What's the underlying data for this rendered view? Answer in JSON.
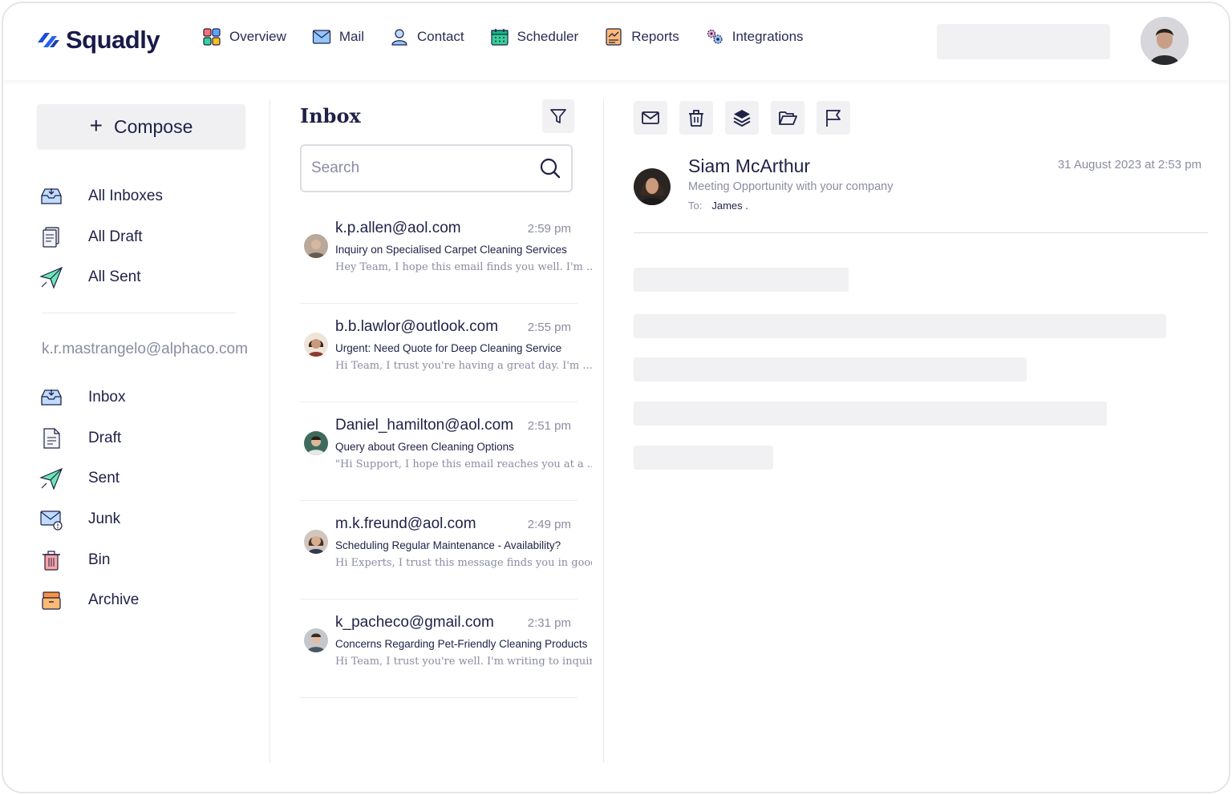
{
  "brand": {
    "name": "Squadly"
  },
  "nav": {
    "items": [
      {
        "label": "Overview",
        "icon": "overview-icon"
      },
      {
        "label": "Mail",
        "icon": "mail-icon"
      },
      {
        "label": "Contact",
        "icon": "contact-icon"
      },
      {
        "label": "Scheduler",
        "icon": "calendar-icon"
      },
      {
        "label": "Reports",
        "icon": "report-icon"
      },
      {
        "label": "Integrations",
        "icon": "integrations-icon"
      }
    ]
  },
  "sidebar": {
    "compose_label": "Compose",
    "global": [
      {
        "label": "All Inboxes",
        "icon": "inbox-icon"
      },
      {
        "label": "All Draft",
        "icon": "draft-icon"
      },
      {
        "label": "All Sent",
        "icon": "sent-icon"
      }
    ],
    "account": "k.r.mastrangelo@alphaco.com",
    "folders": [
      {
        "label": "Inbox",
        "icon": "inbox-icon"
      },
      {
        "label": "Draft",
        "icon": "draft-icon"
      },
      {
        "label": "Sent",
        "icon": "sent-icon"
      },
      {
        "label": "Junk",
        "icon": "junk-icon"
      },
      {
        "label": "Bin",
        "icon": "bin-icon"
      },
      {
        "label": "Archive",
        "icon": "archive-icon"
      }
    ]
  },
  "inbox": {
    "title": "Inbox",
    "search_placeholder": "Search",
    "messages": [
      {
        "from": "k.p.allen@aol.com",
        "time": "2:59 pm",
        "subject": "Inquiry on Specialised Carpet Cleaning Services",
        "preview": "Hey Team, I hope this email finds you well. I'm ..."
      },
      {
        "from": "b.b.lawlor@outlook.com",
        "time": "2:55 pm",
        "subject": "Urgent: Need Quote for Deep Cleaning Service",
        "preview": "Hi Team, I trust you're having a great day. I'm ..."
      },
      {
        "from": "Daniel_hamilton@aol.com",
        "time": "2:51 pm",
        "subject": "Query about Green Cleaning Options",
        "preview": "\"Hi Support, I hope this email reaches you at a ..."
      },
      {
        "from": "m.k.freund@aol.com",
        "time": "2:49 pm",
        "subject": "Scheduling Regular Maintenance - Availability?",
        "preview": "Hi Experts, I trust this message finds you in good ..."
      },
      {
        "from": "k_pacheco@gmail.com",
        "time": "2:31 pm",
        "subject": "Concerns Regarding Pet-Friendly Cleaning Products",
        "preview": "Hi Team, I trust you're well. I'm writing to inquire ..."
      }
    ]
  },
  "reader": {
    "toolbar": [
      "mail-icon",
      "trash-icon",
      "layers-icon",
      "folder-open-icon",
      "flag-icon"
    ],
    "sender": "Siam McArthur",
    "subject": "Meeting Opportunity with your company",
    "to_label": "To:",
    "to": "James .",
    "date": "31 August 2023 at 2:53 pm"
  },
  "colors": {
    "brand": "#1d4ed8",
    "text": "#1f2147",
    "muted": "#8a8ca3",
    "placeholder": "#f1f1f4"
  }
}
